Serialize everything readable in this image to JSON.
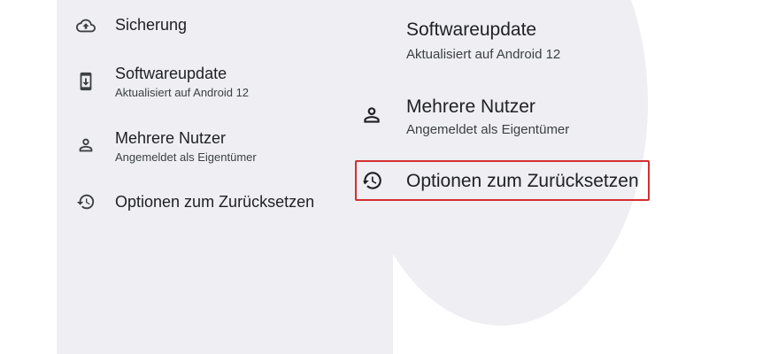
{
  "settings": {
    "items": [
      {
        "icon": "cloud-upload-icon",
        "title": "Sicherung",
        "subtitle": ""
      },
      {
        "icon": "system-update-icon",
        "title": "Softwareupdate",
        "subtitle": "Aktualisiert auf Android 12"
      },
      {
        "icon": "person-icon",
        "title": "Mehrere Nutzer",
        "subtitle": "Angemeldet als Eigentümer"
      },
      {
        "icon": "history-icon",
        "title": "Optionen zum Zurücksetzen",
        "subtitle": ""
      }
    ]
  },
  "magnifier": {
    "partial_title": "Softwareupdate",
    "partial_subtitle": "Aktualisiert auf Android 12",
    "user_title": "Mehrere Nutzer",
    "user_subtitle": "Angemeldet als Eigentümer",
    "reset_title": "Optionen zum Zurücksetzen"
  },
  "colors": {
    "panel_bg": "#efeff3",
    "highlight": "#d32f2f"
  }
}
